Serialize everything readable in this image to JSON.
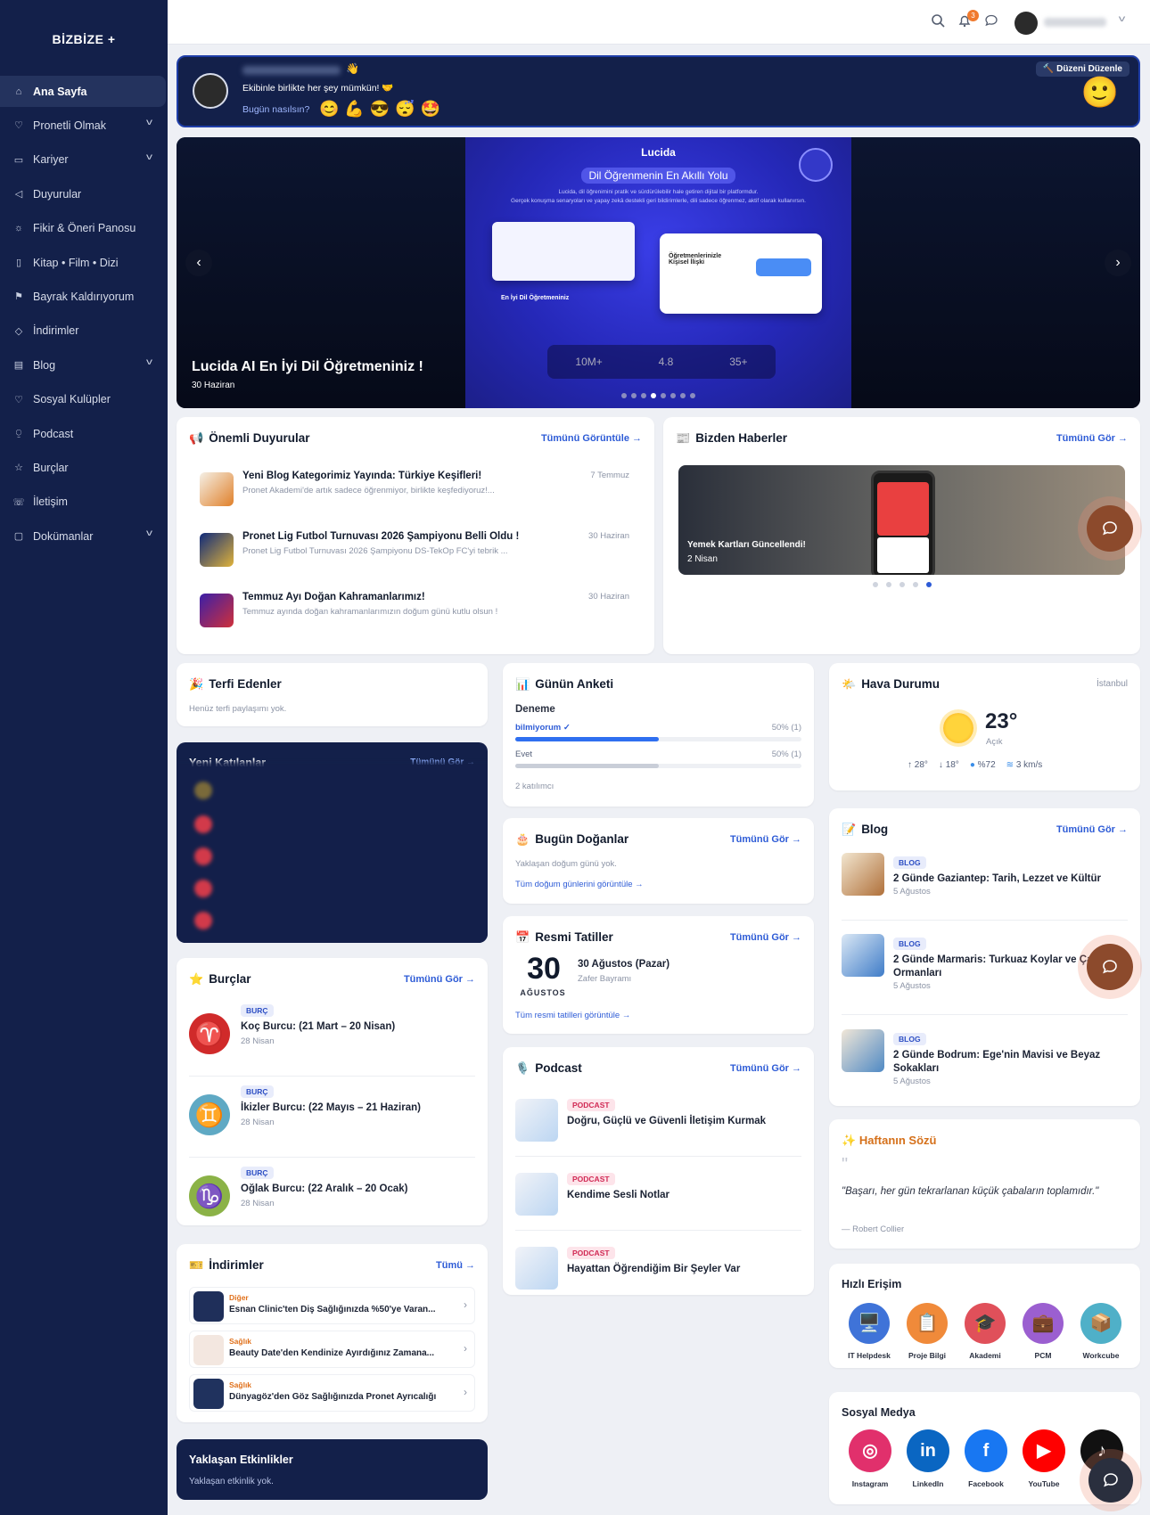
{
  "sidebar": {
    "logo": "BİZBİZE +",
    "items": [
      {
        "label": "Ana Sayfa",
        "icon": "home-icon",
        "active": true
      },
      {
        "label": "Pronetli Olmak",
        "icon": "shield-heart-icon",
        "has_children": true
      },
      {
        "label": "Kariyer",
        "icon": "briefcase-icon",
        "has_children": true
      },
      {
        "label": "Duyurular",
        "icon": "megaphone-icon"
      },
      {
        "label": "Fikir & Öneri Panosu",
        "icon": "lightbulb-icon"
      },
      {
        "label": "Kitap • Film • Dizi",
        "icon": "book-icon"
      },
      {
        "label": "Bayrak Kaldırıyorum",
        "icon": "flag-icon"
      },
      {
        "label": "İndirimler",
        "icon": "tag-icon"
      },
      {
        "label": "Blog",
        "icon": "newspaper-icon",
        "has_children": true
      },
      {
        "label": "Sosyal Kulüpler",
        "icon": "heart-icon"
      },
      {
        "label": "Podcast",
        "icon": "microphone-icon"
      },
      {
        "label": "Burçlar",
        "icon": "star-icon"
      },
      {
        "label": "İletişim",
        "icon": "phone-icon"
      },
      {
        "label": "Dokümanlar",
        "icon": "document-icon",
        "has_children": true
      }
    ]
  },
  "topbar": {
    "notification_count": "3"
  },
  "welcome": {
    "wave": "👋",
    "subtitle": "Ekibinle birlikte her şey mümkün! 🤝",
    "mood_prompt": "Bugün nasılsın?",
    "moods": [
      "😊",
      "💪",
      "😎",
      "😴",
      "🤩"
    ],
    "edit_label": "Düzeni Düzenle",
    "current_mood": "🙂"
  },
  "hero": {
    "title": "Lucida AI En İyi Dil Öğretmeniniz !",
    "date": "30 Haziran",
    "brand": "Lucida",
    "banner_heading": "Dil Öğrenmenin En Akıllı Yolu",
    "banner_text": "Lucida, dil öğrenimini pratik ve sürdürülebilir hale getiren dijital bir platformdur.",
    "banner_text2": "Gerçek konuşma senaryoları ve yapay zekâ destekli geri bildirimlerle, dili sadece öğrenmez, aktif olarak kullanırsın.",
    "card1_title": "En İyi Dil Öğretmeniniz",
    "card2_title": "Öğretmenlerinizle Kişisel İlişki",
    "stats": [
      "10M+",
      "4.8",
      "35+"
    ],
    "dots": 8,
    "active_dot": 3
  },
  "announcements": {
    "title": "Önemli Duyurular",
    "see_all": "Tümünü Görüntüle →",
    "items": [
      {
        "title": "Yeni Blog Kategorimiz Yayında: Türkiye Keşifleri!",
        "excerpt": "Pronet Akademi'de artık sadece öğrenmiyor, birlikte keşfediyoruz!...",
        "date": "7 Temmuz"
      },
      {
        "title": "Pronet Lig Futbol Turnuvası 2026 Şampiyonu Belli Oldu !",
        "excerpt": "Pronet Lig Futbol Turnuvası 2026 Şampiyonu DS-TekOp FC'yi tebrik ...",
        "date": "30 Haziran"
      },
      {
        "title": "Temmuz Ayı Doğan Kahramanlarımız!",
        "excerpt": "Temmuz ayında doğan kahramanlarımızın doğum günü kutlu olsun !",
        "date": "30 Haziran"
      }
    ]
  },
  "news": {
    "title": "Bizden Haberler",
    "see_all": "Tümünü Gör →",
    "slide_title": "Yemek Kartları Güncellendi!",
    "slide_date": "2 Nisan",
    "dots": 5,
    "active_dot": 4
  },
  "promotions": {
    "title": "Terfi Edenler",
    "empty": "Henüz terfi paylaşımı yok."
  },
  "newcomers": {
    "title": "Yeni Katılanlar",
    "see_all": "Tümünü Gör →"
  },
  "poll": {
    "title": "Günün Anketi",
    "question": "Deneme",
    "options": [
      {
        "label": "bilmiyorum ✓",
        "result": "50% (1)",
        "share": 0.5,
        "selected": true
      },
      {
        "label": "Evet",
        "result": "50% (1)",
        "share": 0.5,
        "selected": false
      }
    ],
    "participants": "2 katılımcı"
  },
  "weather": {
    "title": "Hava Durumu",
    "city": "İstanbul",
    "temp": "23°",
    "condition": "Açık",
    "high": "28°",
    "low": "18°",
    "humidity": "%72",
    "wind": "3 km/s"
  },
  "birthdays": {
    "title": "Bugün Doğanlar",
    "see_all": "Tümünü Gör →",
    "empty": "Yaklaşan doğum günü yok.",
    "link": "Tüm doğum günlerini görüntüle →"
  },
  "holidays": {
    "title": "Resmi Tatiller",
    "see_all": "Tümünü Gör →",
    "day": "30",
    "month": "AĞUSTOS",
    "name": "30 Ağustos (Pazar)",
    "desc": "Zafer Bayramı",
    "link": "Tüm resmi tatilleri görüntüle →"
  },
  "zodiac": {
    "title": "Burçlar",
    "see_all": "Tümünü Gör →",
    "items": [
      {
        "tag": "BURÇ",
        "title": "Koç Burcu: (21 Mart – 20 Nisan)",
        "date": "28 Nisan",
        "symbol": "♈",
        "color": "#d02a2a"
      },
      {
        "tag": "BURÇ",
        "title": "İkizler Burcu: (22 Mayıs – 21 Haziran)",
        "date": "28 Nisan",
        "symbol": "♊",
        "color": "#5fa9c4"
      },
      {
        "tag": "BURÇ",
        "title": "Oğlak Burcu: (22 Aralık – 20 Ocak)",
        "date": "28 Nisan",
        "symbol": "♑",
        "color": "#8bb247"
      }
    ]
  },
  "podcast": {
    "title": "Podcast",
    "see_all": "Tümünü Gör →",
    "items": [
      {
        "tag": "PODCAST",
        "title": "Doğru, Güçlü ve Güvenli İletişim Kurmak"
      },
      {
        "tag": "PODCAST",
        "title": "Kendime Sesli Notlar"
      },
      {
        "tag": "PODCAST",
        "title": "Hayattan Öğrendiğim Bir Şeyler Var"
      }
    ]
  },
  "blog": {
    "title": "Blog",
    "see_all": "Tümünü Gör →",
    "items": [
      {
        "tag": "BLOG",
        "title": "2 Günde Gaziantep: Tarih, Lezzet ve Kültür",
        "date": "5 Ağustos"
      },
      {
        "tag": "BLOG",
        "title": "2 Günde Marmaris: Turkuaz Koylar ve Çam Ormanları",
        "date": "5 Ağustos"
      },
      {
        "tag": "BLOG",
        "title": "2 Günde Bodrum: Ege'nin Mavisi ve Beyaz Sokakları",
        "date": "5 Ağustos"
      }
    ]
  },
  "quote": {
    "title": "Haftanın Sözü",
    "text": "\"Başarı, her gün tekrarlanan küçük çabaların toplamıdır.\"",
    "author": "— Robert Collier"
  },
  "discounts": {
    "title": "İndirimler",
    "see_all": "Tümü →",
    "items": [
      {
        "category": "Diğer",
        "title": "Esnan Clinic'ten Diş Sağlığınızda %50'ye Varan..."
      },
      {
        "category": "Sağlık",
        "title": "Beauty Date'den Kendinize Ayırdığınız Zamana..."
      },
      {
        "category": "Sağlık",
        "title": "Dünyagöz'den Göz Sağlığınızda Pronet Ayrıcalığı"
      }
    ]
  },
  "events": {
    "title": "Yaklaşan Etkinlikler",
    "empty": "Yaklaşan etkinlik yok."
  },
  "quick_access": {
    "title": "Hızlı Erişim",
    "items": [
      {
        "label": "IT Helpdesk",
        "icon": "computer-icon",
        "emoji": "🖥️",
        "color": "#3f73d8"
      },
      {
        "label": "Proje Bilgi",
        "icon": "clipboard-icon",
        "emoji": "📋",
        "color": "#f08a3a"
      },
      {
        "label": "Akademi",
        "icon": "graduation-cap-icon",
        "emoji": "🎓",
        "color": "#e0505a"
      },
      {
        "label": "PCM",
        "icon": "briefcase-icon",
        "emoji": "💼",
        "color": "#9b5fd0"
      },
      {
        "label": "Workcube",
        "icon": "box-icon",
        "emoji": "📦",
        "color": "#4fb0c8"
      }
    ]
  },
  "social": {
    "title": "Sosyal Medya",
    "items": [
      {
        "label": "Instagram",
        "icon": "instagram-icon",
        "color": "#e1306c"
      },
      {
        "label": "LinkedIn",
        "icon": "linkedin-icon",
        "color": "#0a66c2"
      },
      {
        "label": "Facebook",
        "icon": "facebook-icon",
        "color": "#1877f2"
      },
      {
        "label": "YouTube",
        "icon": "youtube-icon",
        "color": "#ff0000"
      },
      {
        "label": "TikTok",
        "icon": "tiktok-icon",
        "color": "#111111"
      }
    ]
  }
}
